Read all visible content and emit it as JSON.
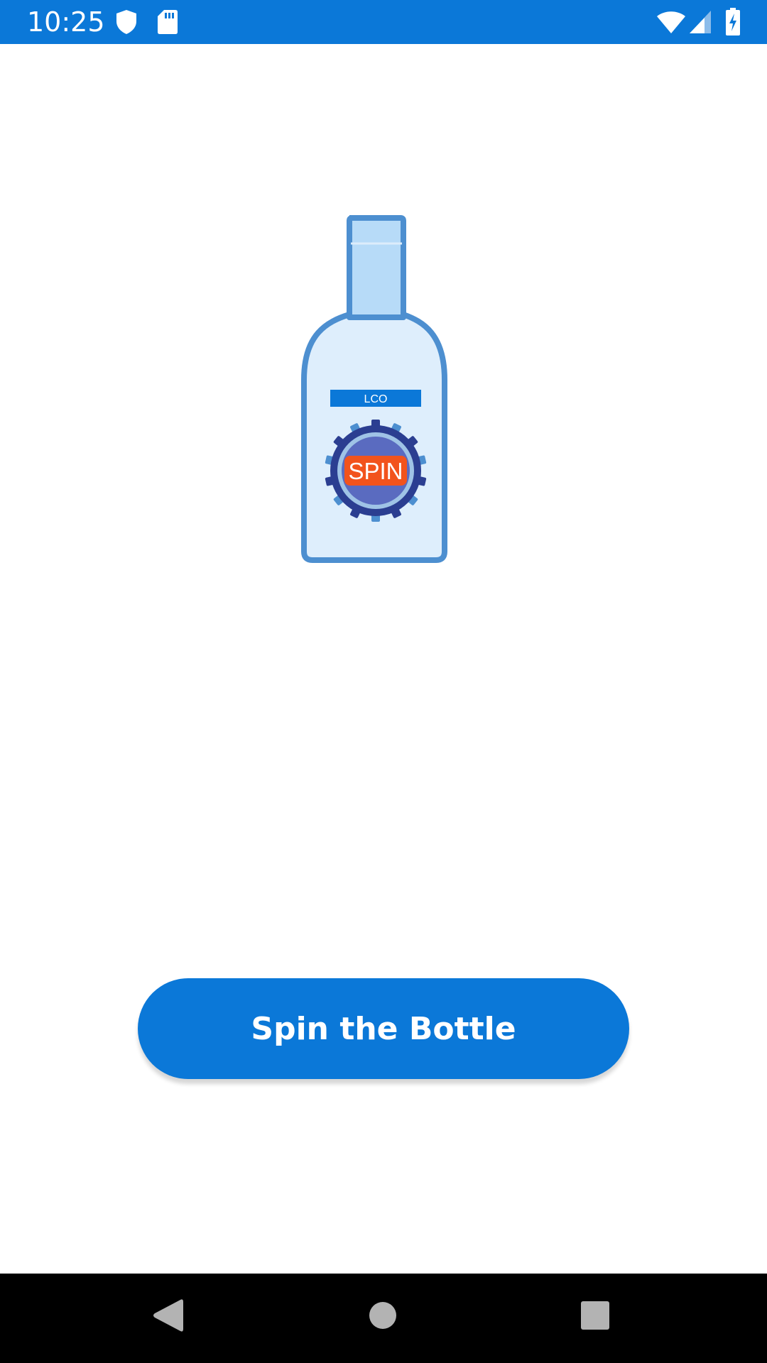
{
  "status_bar": {
    "time": "10:25",
    "background": "#0b78d8",
    "left_icons": [
      "shield-icon",
      "sd-card-icon"
    ],
    "right_icons": [
      "wifi-icon",
      "cell-signal-icon",
      "battery-charging-icon"
    ]
  },
  "bottle": {
    "label_text": "LCO",
    "badge_text": "SPIN",
    "colors": {
      "outline": "#4d8fd0",
      "body_fill": "#deeefc",
      "neck_fill": "#b7dbf8",
      "label_fill": "#0b78d8",
      "badge_fill": "#f2531c",
      "gear_outer": "#2b3e91",
      "gear_ring": "#9fc3e6",
      "gear_inner": "#5a6bc0"
    }
  },
  "main": {
    "spin_button_label": "Spin the Bottle"
  },
  "nav_bar": {
    "buttons": [
      "back-icon",
      "home-icon",
      "recents-icon"
    ]
  },
  "colors": {
    "accent": "#0b78d8",
    "background": "#ffffff",
    "nav_background": "#000000"
  }
}
